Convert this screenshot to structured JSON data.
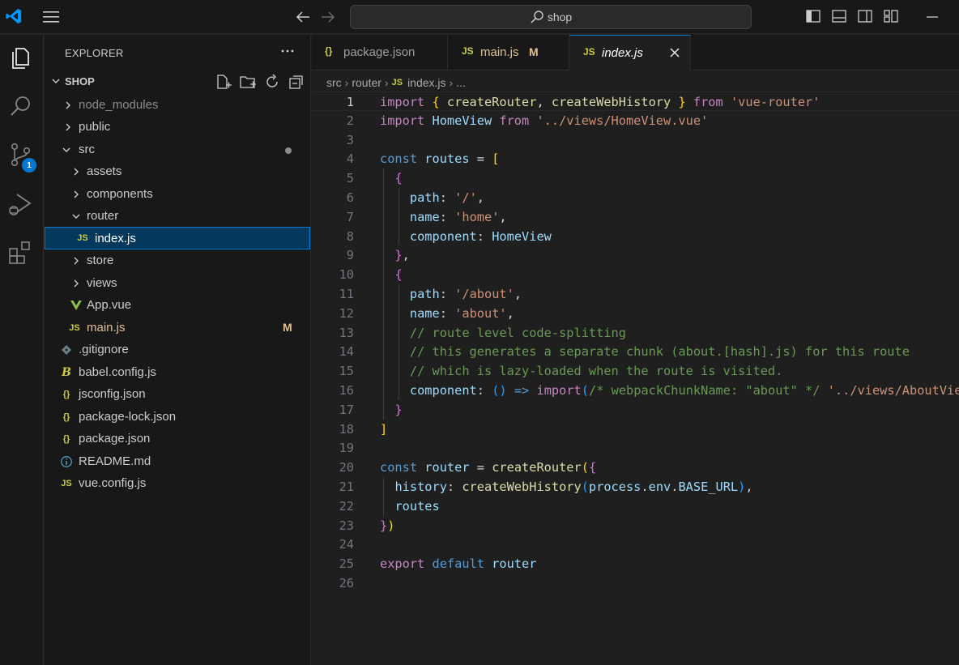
{
  "titlebar": {
    "search_text": "shop"
  },
  "activity_bar": {
    "scm_badge": "1"
  },
  "sidebar": {
    "title": "EXPLORER",
    "section": "SHOP",
    "tree": [
      {
        "name": "node_modules",
        "type": "folder",
        "depth": 0,
        "expanded": false,
        "dim": true
      },
      {
        "name": "public",
        "type": "folder",
        "depth": 0,
        "expanded": false
      },
      {
        "name": "src",
        "type": "folder",
        "depth": 0,
        "expanded": true,
        "modified_dot": true
      },
      {
        "name": "assets",
        "type": "folder",
        "depth": 1,
        "expanded": false
      },
      {
        "name": "components",
        "type": "folder",
        "depth": 1,
        "expanded": false
      },
      {
        "name": "router",
        "type": "folder",
        "depth": 1,
        "expanded": true
      },
      {
        "name": "index.js",
        "type": "js",
        "depth": 2,
        "selected": true
      },
      {
        "name": "store",
        "type": "folder",
        "depth": 1,
        "expanded": false
      },
      {
        "name": "views",
        "type": "folder",
        "depth": 1,
        "expanded": false
      },
      {
        "name": "App.vue",
        "type": "vue",
        "depth": 1
      },
      {
        "name": "main.js",
        "type": "js",
        "depth": 1,
        "status": "M"
      },
      {
        "name": ".gitignore",
        "type": "git",
        "depth": 0
      },
      {
        "name": "babel.config.js",
        "type": "babel",
        "depth": 0
      },
      {
        "name": "jsconfig.json",
        "type": "json",
        "depth": 0
      },
      {
        "name": "package-lock.json",
        "type": "json",
        "depth": 0
      },
      {
        "name": "package.json",
        "type": "json",
        "depth": 0
      },
      {
        "name": "README.md",
        "type": "info",
        "depth": 0
      },
      {
        "name": "vue.config.js",
        "type": "js",
        "depth": 0
      }
    ]
  },
  "tabs": [
    {
      "icon": "{}",
      "label": "package.json",
      "active": false
    },
    {
      "icon": "JS",
      "label": "main.js",
      "status": "M",
      "active": false
    },
    {
      "icon": "JS",
      "label": "index.js",
      "active": true
    }
  ],
  "breadcrumb": {
    "parts": [
      "src",
      "router",
      "index.js",
      "..."
    ],
    "file_icon": "JS"
  },
  "editor": {
    "language": "javascript",
    "cursor_line": 1,
    "lines": [
      "import { createRouter, createWebHistory } from 'vue-router'",
      "import HomeView from '../views/HomeView.vue'",
      "",
      "const routes = [",
      "  {",
      "    path: '/',",
      "    name: 'home',",
      "    component: HomeView",
      "  },",
      "  {",
      "    path: '/about',",
      "    name: 'about',",
      "    // route level code-splitting",
      "    // this generates a separate chunk (about.[hash].js) for this route",
      "    // which is lazy-loaded when the route is visited.",
      "    component: () => import(/* webpackChunkName: \"about\" */ '../views/AboutView.vue')",
      "  }",
      "]",
      "",
      "const router = createRouter({",
      "  history: createWebHistory(process.env.BASE_URL),",
      "  routes",
      "})",
      "",
      "export default router",
      ""
    ]
  },
  "colors": {
    "accent": "#0078d4",
    "modified": "#e2c08d",
    "js_icon": "#cbcb41",
    "vue_icon": "#8dc149",
    "background": "#1f1f1f",
    "sidebar_bg": "#181818"
  }
}
